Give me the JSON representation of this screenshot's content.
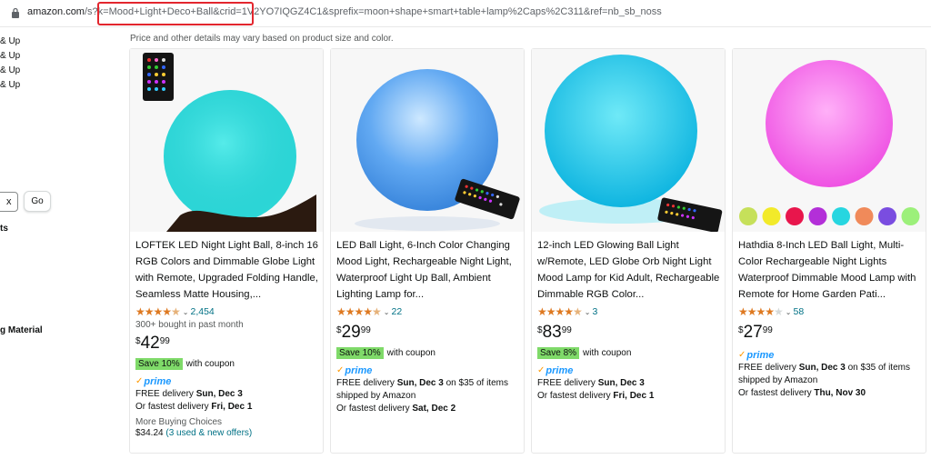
{
  "browser": {
    "url_host": "amazon.com",
    "url_path": "/s?k=Mood+Light+Deco+Ball&crid=1V2YO7IQGZ4C1&sprefix=moon+shape+smart+table+lamp%2Caps%2C311&ref=nb_sb_noss"
  },
  "sidebar": {
    "lines": [
      "& Up",
      "& Up",
      "& Up",
      "& Up"
    ],
    "min_value": "x",
    "go_label": "Go",
    "ts_label": "ts",
    "material_label": "g Material"
  },
  "note": "Price and other details may vary based on product size and color.",
  "products": [
    {
      "title": "LOFTEK LED Night Light Ball, 8-inch 16 RGB Colors and Dimmable Globe Light with Remote, Upgraded Folding Handle, Seamless Matte Housing,...",
      "stars": 4.5,
      "rating_count": "2,454",
      "bought": "300+ bought in past month",
      "price_symbol": "$",
      "price_whole": "42",
      "price_fraction": "99",
      "coupon": "Save 10%",
      "coupon_suffix": "with coupon",
      "prime": "prime",
      "delivery_1_prefix": "FREE delivery ",
      "delivery_1_date": "Sun, Dec 3",
      "delivery_1_suffix": "",
      "delivery_2_prefix": "Or fastest delivery ",
      "delivery_2_date": "Fri, Dec 1",
      "more_label": "More Buying Choices",
      "more_price": "$34.24",
      "more_offers": "(3 used & new offers)",
      "ball_color": "#2fd8d8"
    },
    {
      "title": "LED Ball Light, 6-Inch Color Changing Mood Light, Rechargeable Night Light, Waterproof Light Up Ball, Ambient Lighting Lamp for...",
      "stars": 4.5,
      "rating_count": "22",
      "price_symbol": "$",
      "price_whole": "29",
      "price_fraction": "99",
      "coupon": "Save 10%",
      "coupon_suffix": "with coupon",
      "prime": "prime",
      "delivery_1_prefix": "FREE delivery ",
      "delivery_1_date": "Sun, Dec 3",
      "delivery_1_suffix": " on $35 of items shipped by Amazon",
      "delivery_2_prefix": "Or fastest delivery ",
      "delivery_2_date": "Sat, Dec 2",
      "ball_color": "#5ab0f0"
    },
    {
      "title": "12-inch LED Glowing Ball Light w/Remote, LED Globe Orb Night Light Mood Lamp for Kid Adult, Rechargeable Dimmable RGB Color...",
      "stars": 4.5,
      "rating_count": "3",
      "price_symbol": "$",
      "price_whole": "83",
      "price_fraction": "99",
      "coupon": "Save 8%",
      "coupon_suffix": "with coupon",
      "prime": "prime",
      "delivery_1_prefix": "FREE delivery ",
      "delivery_1_date": "Sun, Dec 3",
      "delivery_1_suffix": "",
      "delivery_2_prefix": "Or fastest delivery ",
      "delivery_2_date": "Fri, Dec 1",
      "ball_color": "#1fc4e8"
    },
    {
      "title": "Hathdia 8-Inch LED Ball Light, Multi-Color Rechargeable Night Lights Waterproof Dimmable Mood Lamp with Remote for Home Garden Pati...",
      "stars": 4.0,
      "rating_count": "58",
      "price_symbol": "$",
      "price_whole": "27",
      "price_fraction": "99",
      "prime": "prime",
      "delivery_1_prefix": "FREE delivery ",
      "delivery_1_date": "Sun, Dec 3",
      "delivery_1_suffix": " on $35 of items shipped by Amazon",
      "delivery_2_prefix": "Or fastest delivery ",
      "delivery_2_date": "Thu, Nov 30",
      "ball_color": "#f06be8",
      "swatches": [
        "#c6e05a",
        "#f2ea2a",
        "#e8164c",
        "#b32fd8",
        "#27d6e0",
        "#f08a5a",
        "#7a4de0",
        "#9cf07a"
      ]
    }
  ]
}
